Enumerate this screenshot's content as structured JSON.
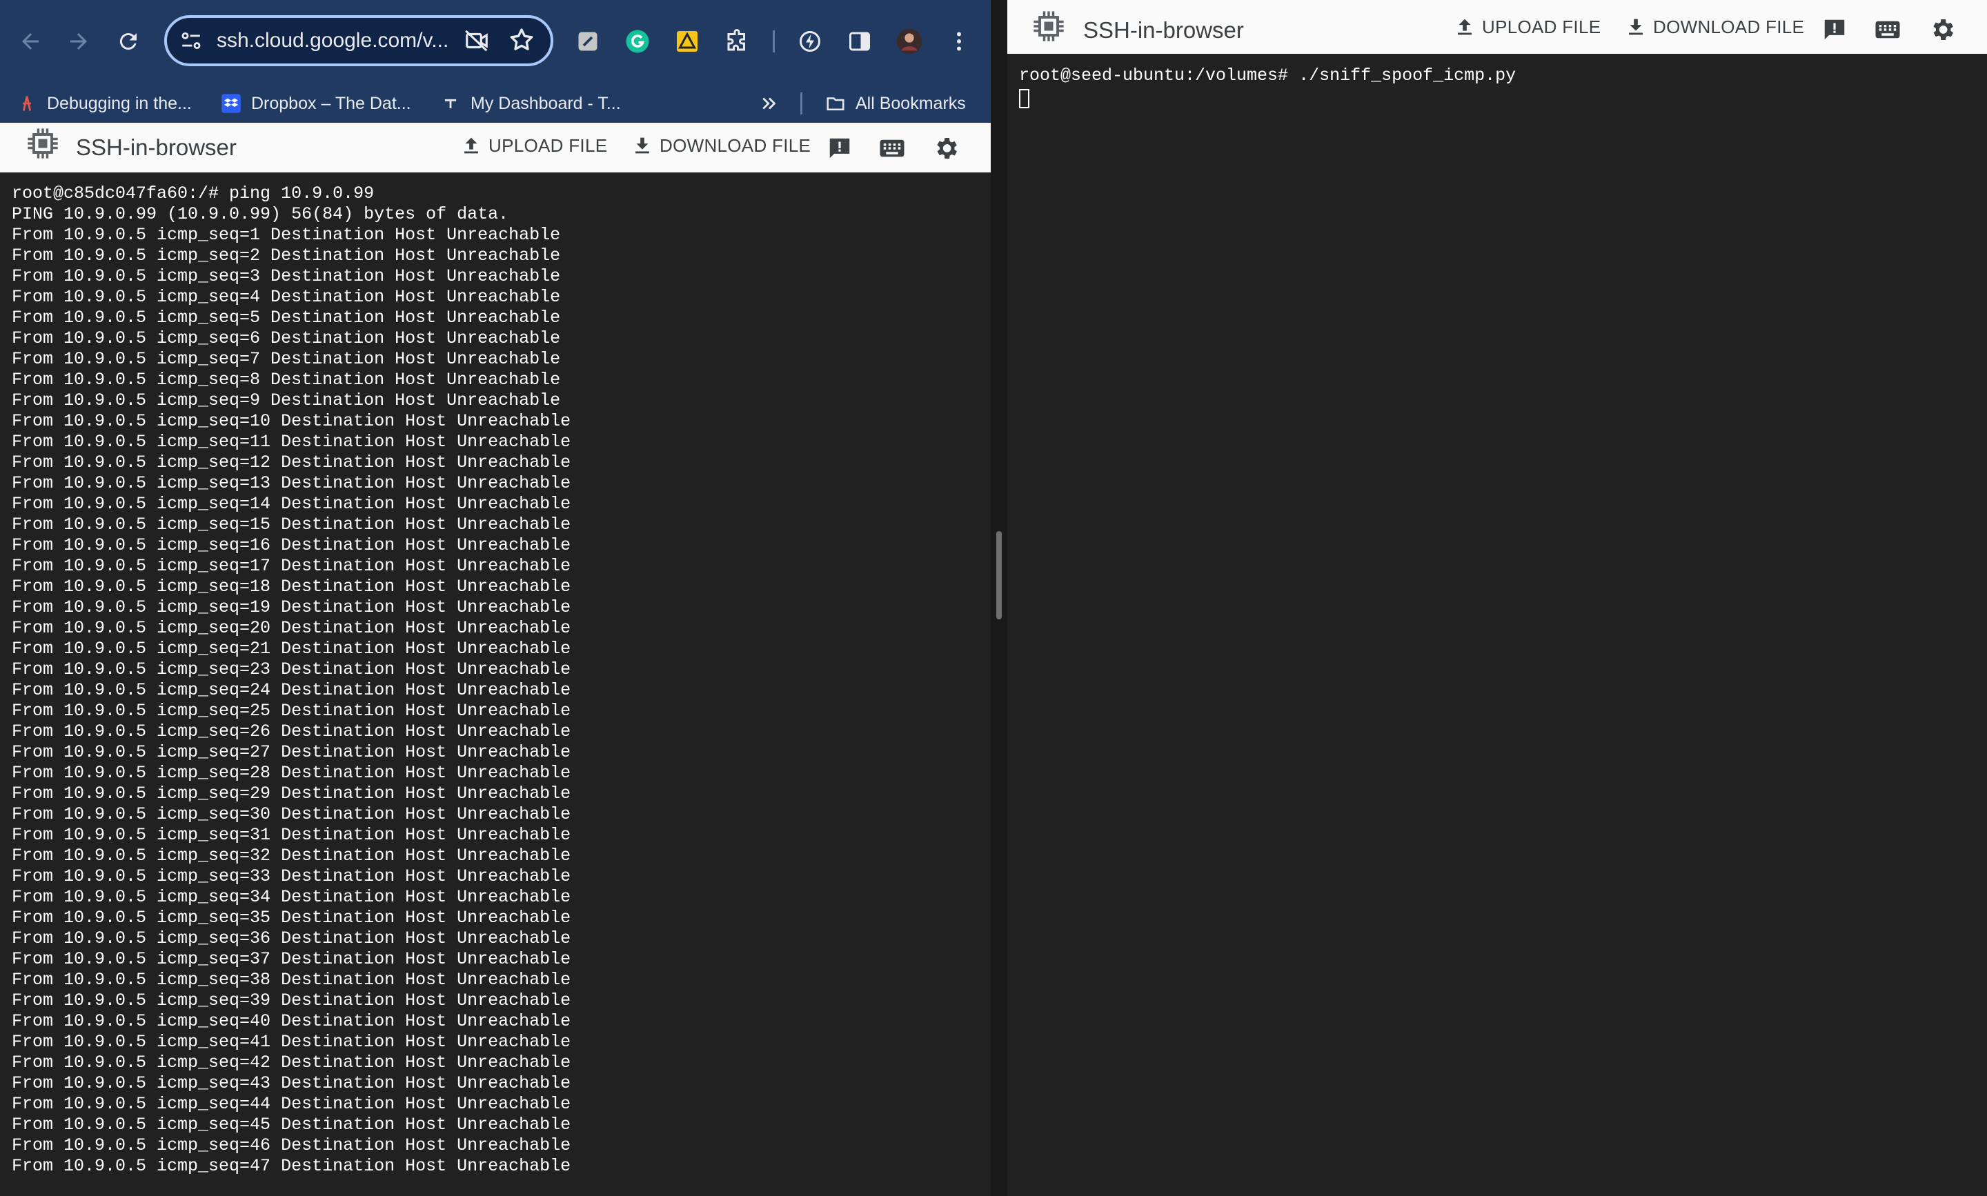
{
  "browser": {
    "url": "ssh.cloud.google.com/v...",
    "bookmarks": [
      {
        "label": "Debugging in the...",
        "icon": "debug-icon"
      },
      {
        "label": "Dropbox – The Dat...",
        "icon": "dropbox-icon"
      },
      {
        "label": "My Dashboard - T...",
        "icon": "dashboard-icon"
      }
    ],
    "all_bookmarks_label": "All Bookmarks",
    "colors": {
      "toolbar": "#213a62",
      "omnibox_border": "#a8c7fa"
    }
  },
  "left_ssh": {
    "title": "SSH-in-browser",
    "upload_label": "UPLOAD FILE",
    "download_label": "DOWNLOAD FILE",
    "terminal_lines": [
      "root@c85dc047fa60:/# ping 10.9.0.99",
      "PING 10.9.0.99 (10.9.0.99) 56(84) bytes of data.",
      "From 10.9.0.5 icmp_seq=1 Destination Host Unreachable",
      "From 10.9.0.5 icmp_seq=2 Destination Host Unreachable",
      "From 10.9.0.5 icmp_seq=3 Destination Host Unreachable",
      "From 10.9.0.5 icmp_seq=4 Destination Host Unreachable",
      "From 10.9.0.5 icmp_seq=5 Destination Host Unreachable",
      "From 10.9.0.5 icmp_seq=6 Destination Host Unreachable",
      "From 10.9.0.5 icmp_seq=7 Destination Host Unreachable",
      "From 10.9.0.5 icmp_seq=8 Destination Host Unreachable",
      "From 10.9.0.5 icmp_seq=9 Destination Host Unreachable",
      "From 10.9.0.5 icmp_seq=10 Destination Host Unreachable",
      "From 10.9.0.5 icmp_seq=11 Destination Host Unreachable",
      "From 10.9.0.5 icmp_seq=12 Destination Host Unreachable",
      "From 10.9.0.5 icmp_seq=13 Destination Host Unreachable",
      "From 10.9.0.5 icmp_seq=14 Destination Host Unreachable",
      "From 10.9.0.5 icmp_seq=15 Destination Host Unreachable",
      "From 10.9.0.5 icmp_seq=16 Destination Host Unreachable",
      "From 10.9.0.5 icmp_seq=17 Destination Host Unreachable",
      "From 10.9.0.5 icmp_seq=18 Destination Host Unreachable",
      "From 10.9.0.5 icmp_seq=19 Destination Host Unreachable",
      "From 10.9.0.5 icmp_seq=20 Destination Host Unreachable",
      "From 10.9.0.5 icmp_seq=21 Destination Host Unreachable",
      "From 10.9.0.5 icmp_seq=23 Destination Host Unreachable",
      "From 10.9.0.5 icmp_seq=24 Destination Host Unreachable",
      "From 10.9.0.5 icmp_seq=25 Destination Host Unreachable",
      "From 10.9.0.5 icmp_seq=26 Destination Host Unreachable",
      "From 10.9.0.5 icmp_seq=27 Destination Host Unreachable",
      "From 10.9.0.5 icmp_seq=28 Destination Host Unreachable",
      "From 10.9.0.5 icmp_seq=29 Destination Host Unreachable",
      "From 10.9.0.5 icmp_seq=30 Destination Host Unreachable",
      "From 10.9.0.5 icmp_seq=31 Destination Host Unreachable",
      "From 10.9.0.5 icmp_seq=32 Destination Host Unreachable",
      "From 10.9.0.5 icmp_seq=33 Destination Host Unreachable",
      "From 10.9.0.5 icmp_seq=34 Destination Host Unreachable",
      "From 10.9.0.5 icmp_seq=35 Destination Host Unreachable",
      "From 10.9.0.5 icmp_seq=36 Destination Host Unreachable",
      "From 10.9.0.5 icmp_seq=37 Destination Host Unreachable",
      "From 10.9.0.5 icmp_seq=38 Destination Host Unreachable",
      "From 10.9.0.5 icmp_seq=39 Destination Host Unreachable",
      "From 10.9.0.5 icmp_seq=40 Destination Host Unreachable",
      "From 10.9.0.5 icmp_seq=41 Destination Host Unreachable",
      "From 10.9.0.5 icmp_seq=42 Destination Host Unreachable",
      "From 10.9.0.5 icmp_seq=43 Destination Host Unreachable",
      "From 10.9.0.5 icmp_seq=44 Destination Host Unreachable",
      "From 10.9.0.5 icmp_seq=45 Destination Host Unreachable",
      "From 10.9.0.5 icmp_seq=46 Destination Host Unreachable",
      "From 10.9.0.5 icmp_seq=47 Destination Host Unreachable"
    ]
  },
  "right_ssh": {
    "title": "SSH-in-browser",
    "upload_label": "UPLOAD FILE",
    "download_label": "DOWNLOAD FILE",
    "terminal_lines": [
      "root@seed-ubuntu:/volumes# ./sniff_spoof_icmp.py"
    ]
  }
}
